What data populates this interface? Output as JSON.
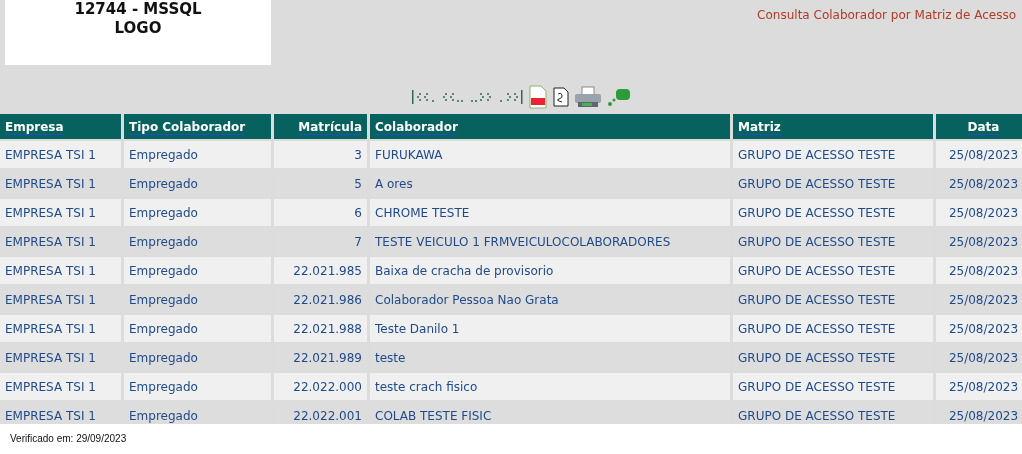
{
  "logo": {
    "lines": [
      "12744 - MSSQL",
      "LOGO"
    ]
  },
  "page_title": "Consulta Colaborador por Matriz de Acesso",
  "table": {
    "columns": [
      {
        "label": "Empresa"
      },
      {
        "label": "Tipo Colaborador"
      },
      {
        "label": "Matrícula"
      },
      {
        "label": "Colaborador"
      },
      {
        "label": "Matriz"
      },
      {
        "label": "Data"
      }
    ],
    "rows": [
      [
        "EMPRESA TSI 1",
        "Empregado",
        "3",
        "FURUKAWA",
        "GRUPO DE ACESSO TESTE",
        "25/08/2023"
      ],
      [
        "EMPRESA TSI 1",
        "Empregado",
        "5",
        "A ores",
        "GRUPO DE ACESSO TESTE",
        "25/08/2023"
      ],
      [
        "EMPRESA TSI 1",
        "Empregado",
        "6",
        "CHROME TESTE",
        "GRUPO DE ACESSO TESTE",
        "25/08/2023"
      ],
      [
        "EMPRESA TSI 1",
        "Empregado",
        "7",
        "TESTE VEICULO 1 FRMVEICULOCOLABORADORES",
        "GRUPO DE ACESSO TESTE",
        "25/08/2023"
      ],
      [
        "EMPRESA TSI 1",
        "Empregado",
        "22.021.985",
        "Baixa de cracha de provisorio",
        "GRUPO DE ACESSO TESTE",
        "25/08/2023"
      ],
      [
        "EMPRESA TSI 1",
        "Empregado",
        "22.021.986",
        "Colaborador Pessoa Nao Grata",
        "GRUPO DE ACESSO TESTE",
        "25/08/2023"
      ],
      [
        "EMPRESA TSI 1",
        "Empregado",
        "22.021.988",
        "Teste Danilo 1",
        "GRUPO DE ACESSO TESTE",
        "25/08/2023"
      ],
      [
        "EMPRESA TSI 1",
        "Empregado",
        "22.021.989",
        "teste",
        "GRUPO DE ACESSO TESTE",
        "25/08/2023"
      ],
      [
        "EMPRESA TSI 1",
        "Empregado",
        "22.022.000",
        "teste crach fisico",
        "GRUPO DE ACESSO TESTE",
        "25/08/2023"
      ],
      [
        "EMPRESA TSI 1",
        "Empregado",
        "22.022.001",
        "COLAB TESTE FISIC",
        "GRUPO DE ACESSO TESTE",
        "25/08/2023"
      ]
    ]
  },
  "footer": "Verificado em: 29/09/2023"
}
